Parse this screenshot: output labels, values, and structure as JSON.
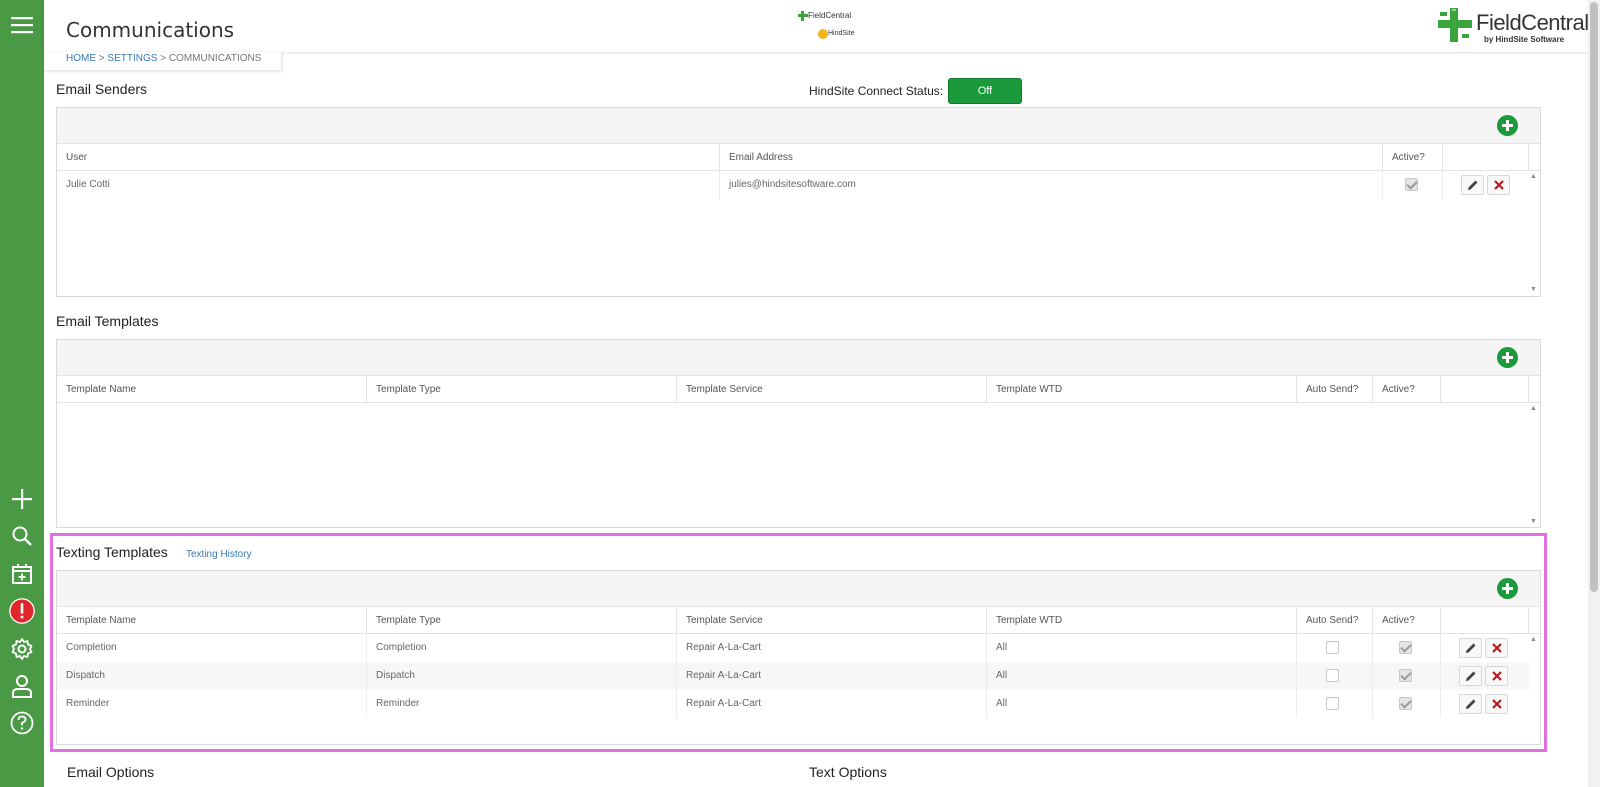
{
  "header": {
    "title": "Communications",
    "breadcrumb": {
      "home": "HOME",
      "sep1": ">",
      "settings": "SETTINGS",
      "sep2": ">",
      "current": "COMMUNICATIONS"
    },
    "center_logo": {
      "line1": "FieldCentral",
      "line2": "HindSite"
    },
    "main_logo": {
      "name": "FieldCentral",
      "sub": "by HindSite Software",
      "color": "#3aa53c"
    }
  },
  "sidebar": {
    "color": "#4a9a45",
    "icons": [
      "menu-icon",
      "add-icon",
      "search-icon",
      "calendar-add-icon",
      "alert-icon",
      "settings-icon",
      "user-icon",
      "help-icon"
    ]
  },
  "email_senders": {
    "title": "Email Senders",
    "connect_label": "HindSite Connect Status:",
    "connect_value": "Off",
    "columns": [
      "User",
      "Email Address",
      "Active?"
    ],
    "rows": [
      {
        "user": "Julie Cotti",
        "email": "julies@hindsitesoftware.com",
        "active": true
      }
    ]
  },
  "email_templates": {
    "title": "Email Templates",
    "columns": [
      "Template Name",
      "Template Type",
      "Template Service",
      "Template WTD",
      "Auto Send?",
      "Active?"
    ],
    "rows": []
  },
  "texting_templates": {
    "title": "Texting Templates",
    "history_link": "Texting History",
    "columns": [
      "Template Name",
      "Template Type",
      "Template Service",
      "Template WTD",
      "Auto Send?",
      "Active?"
    ],
    "rows": [
      {
        "name": "Completion",
        "type": "Completion",
        "service": "Repair A-La-Cart",
        "wtd": "All",
        "auto_send": false,
        "active": true
      },
      {
        "name": "Dispatch",
        "type": "Dispatch",
        "service": "Repair A-La-Cart",
        "wtd": "All",
        "auto_send": false,
        "active": true
      },
      {
        "name": "Reminder",
        "type": "Reminder",
        "service": "Repair A-La-Cart",
        "wtd": "All",
        "auto_send": false,
        "active": true
      }
    ]
  },
  "bottom": {
    "email_options": "Email Options",
    "text_options": "Text Options"
  }
}
